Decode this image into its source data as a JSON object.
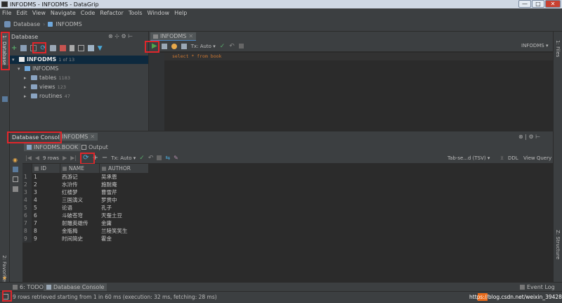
{
  "window": {
    "title": "INFODMS - INFODMS - DataGrip",
    "minimize": "—",
    "maximize": "□",
    "close": "✕"
  },
  "menu": [
    "File",
    "Edit",
    "View",
    "Navigate",
    "Code",
    "Refactor",
    "Tools",
    "Window",
    "Help"
  ],
  "breadcrumb": [
    "Database",
    "INFODMS"
  ],
  "left_strip": {
    "database_tab": "1: Database",
    "favorites_tab": "2: Favorites"
  },
  "right_strip": {
    "files_tab": "1: Files",
    "structure_tab": "Z: Structure"
  },
  "db_panel": {
    "title": "Database",
    "root": {
      "name": "INFODMS",
      "count": "1 of 13"
    },
    "schema": "INFODMS",
    "folders": [
      {
        "name": "tables",
        "count": "1183"
      },
      {
        "name": "views",
        "count": "123"
      },
      {
        "name": "routines",
        "count": "47"
      }
    ]
  },
  "editor": {
    "tab": "INFODMS",
    "tx_mode": "Tx: Auto",
    "schema_selector": "INFODMS",
    "sql": "select * from book"
  },
  "console": {
    "tab_label": "Database Console:",
    "tab_name": "INFODMS",
    "subtabs": [
      "INFODMS.BOOK",
      "Output"
    ],
    "rows_info": "9 rows",
    "tx_mode": "Tx: Auto",
    "format": "Tab-se...d (TSV)",
    "ddl": "DDL",
    "view_query": "View Query",
    "columns": [
      "ID",
      "NAME",
      "AUTHOR"
    ],
    "rows": [
      [
        "1",
        "1",
        "西游记",
        "吴承恩"
      ],
      [
        "2",
        "2",
        "水浒传",
        "施耐庵"
      ],
      [
        "3",
        "3",
        "红楼梦",
        "曹雪芹"
      ],
      [
        "4",
        "4",
        "三国演义",
        "罗贯中"
      ],
      [
        "5",
        "5",
        "论语",
        "孔子"
      ],
      [
        "6",
        "6",
        "斗破苍穹",
        "天蚕土豆"
      ],
      [
        "7",
        "7",
        "射雕英雄传",
        "金庸"
      ],
      [
        "8",
        "8",
        "金瓶梅",
        "兰陵笑笑生"
      ],
      [
        "9",
        "9",
        "时间简史",
        "霍金"
      ]
    ]
  },
  "bottom_tabs": {
    "todo": "6: TODO",
    "db_console": "Database Console",
    "event_log": "Event Log"
  },
  "status": {
    "message": "9 rows retrieved starting from 1 in 60 ms (execution: 32 ms, fetching: 28 ms)",
    "watermark": "https://blog.csdn.net/weixin_39428939"
  },
  "colors": {
    "highlight": "#e0262b",
    "run": "#4ea84a",
    "selection": "#0d293e"
  }
}
